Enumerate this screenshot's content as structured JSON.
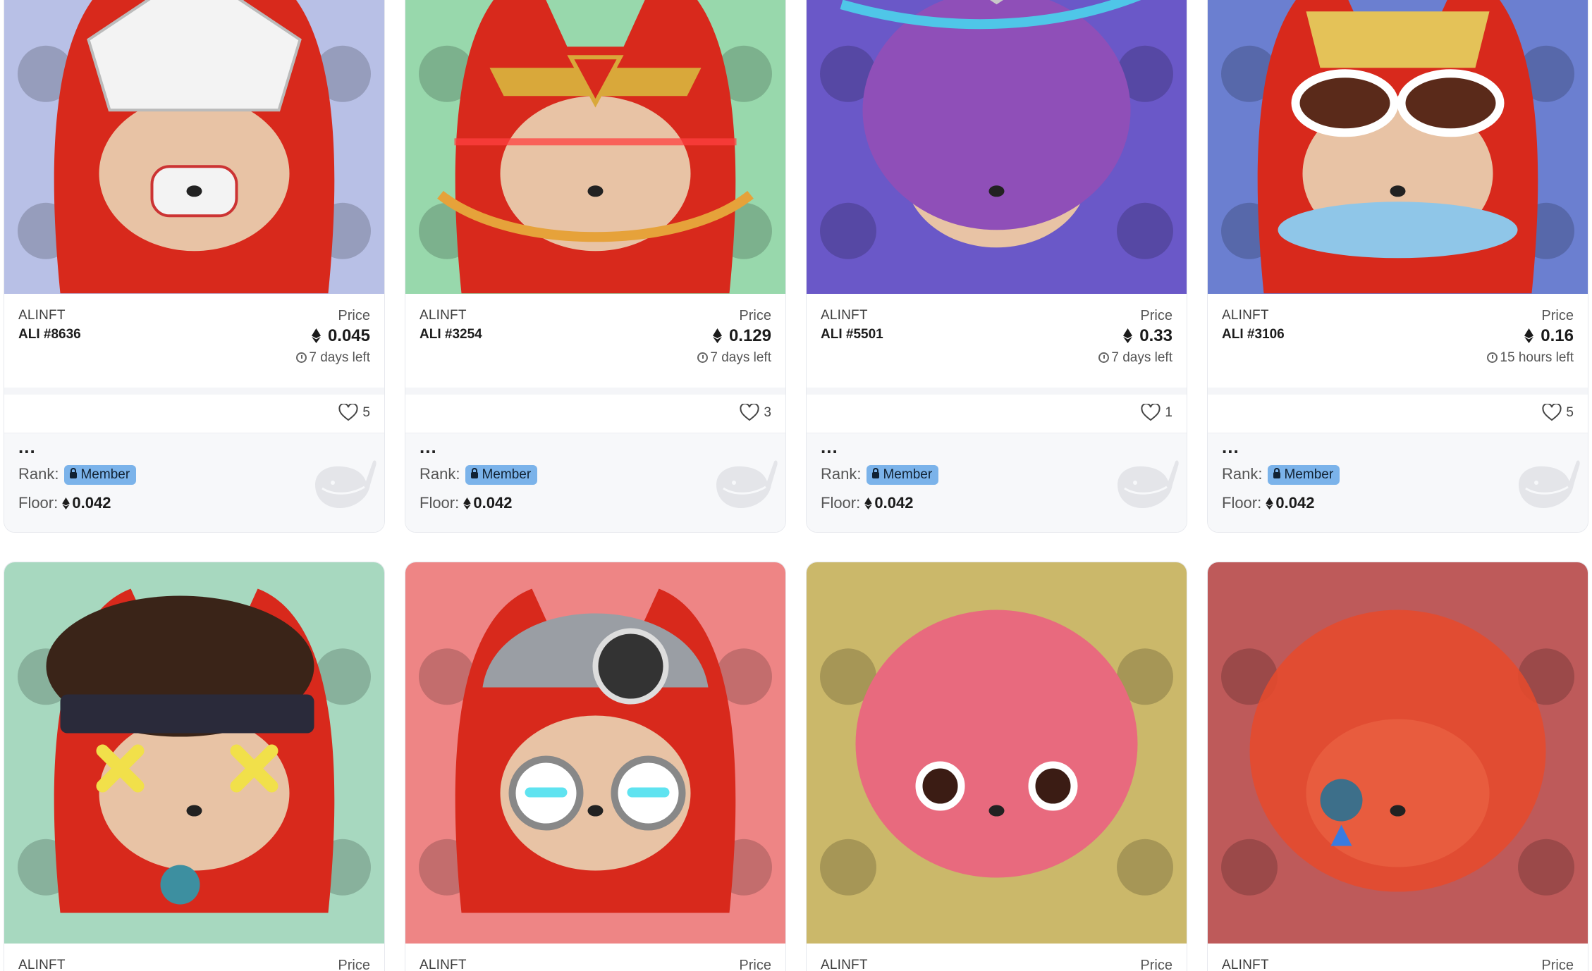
{
  "cards": [
    {
      "collection": "ALINFT",
      "name": "ALI #8636",
      "price_label": "Price",
      "price": "0.045",
      "time_left": "7 days left",
      "likes": "5",
      "dots": "...",
      "rank_label": "Rank:",
      "badge": "Member",
      "floor_label": "Floor:",
      "floor": "0.042",
      "bg": "#b8c0e6",
      "art": "fox-mecha-helmet"
    },
    {
      "collection": "ALINFT",
      "name": "ALI #3254",
      "price_label": "Price",
      "price": "0.129",
      "time_left": "7 days left",
      "likes": "3",
      "dots": "...",
      "rank_label": "Rank:",
      "badge": "Member",
      "floor_label": "Floor:",
      "floor": "0.042",
      "bg": "#98d8ac",
      "art": "fox-golden-crown"
    },
    {
      "collection": "ALINFT",
      "name": "ALI #5501",
      "price_label": "Price",
      "price": "0.33",
      "time_left": "7 days left",
      "likes": "1",
      "dots": "...",
      "rank_label": "Rank:",
      "badge": "Member",
      "floor_label": "Floor:",
      "floor": "0.042",
      "bg": "#6a58c8",
      "art": "fox-ethereum-hood"
    },
    {
      "collection": "ALINFT",
      "name": "ALI #3106",
      "price_label": "Price",
      "price": "0.16",
      "time_left": "15 hours left",
      "likes": "5",
      "dots": "...",
      "rank_label": "Rank:",
      "badge": "Member",
      "floor_label": "Floor:",
      "floor": "0.042",
      "bg": "#6b7fd0",
      "art": "fox-sunglasses-hat"
    },
    {
      "collection": "ALINFT",
      "price_label": "Price",
      "bg": "#a7d8bf",
      "art": "fox-bandana-microphone"
    },
    {
      "collection": "ALINFT",
      "price_label": "Price",
      "bg": "#ee8585",
      "art": "fox-robot-goggles"
    },
    {
      "collection": "ALINFT",
      "price_label": "Price",
      "bg": "#cbb86a",
      "art": "fox-pink-hood"
    },
    {
      "collection": "ALINFT",
      "price_label": "Price",
      "bg": "#be5a5a",
      "art": "fox-jelly-glass"
    }
  ],
  "colors": {
    "accent_badge": "#7bb3ea",
    "fox_red": "#d8291c",
    "fox_face": "#e8c3a5"
  }
}
